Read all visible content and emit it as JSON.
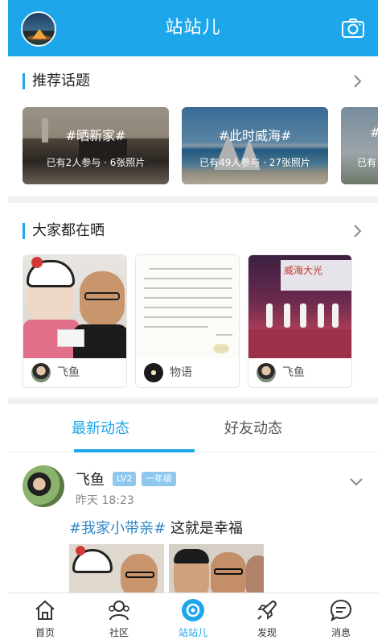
{
  "app": {
    "title": "站站儿"
  },
  "colors": {
    "accent": "#1ea6ea",
    "badge": "#8ec8ee",
    "tag": "#2f86c7"
  },
  "sections": {
    "recommended": {
      "title": "推荐话题",
      "topics": [
        {
          "tag": "#晒新家#",
          "meta": "已有2人参与 · 6张照片"
        },
        {
          "tag": "#此时威海#",
          "meta": "已有49人参与 · 27张照片"
        },
        {
          "tag": "#",
          "meta": "已有"
        }
      ]
    },
    "sharing": {
      "title": "大家都在晒",
      "cards": [
        {
          "user": "飞鱼"
        },
        {
          "user": "物语"
        },
        {
          "user": "飞鱼"
        }
      ],
      "stage_text": "威海大光"
    }
  },
  "tabs": {
    "latest": "最新动态",
    "friends": "好友动态"
  },
  "post": {
    "author": "飞鱼",
    "level": "LV2",
    "grade": "一年级",
    "time": "昨天 18:23",
    "hashtag": "#我家小带亲#",
    "content": " 这就是幸福"
  },
  "nav": [
    {
      "label": "首页",
      "icon": "home-icon"
    },
    {
      "label": "社区",
      "icon": "community-icon"
    },
    {
      "label": "站站儿",
      "icon": "camera-app-icon"
    },
    {
      "label": "发现",
      "icon": "rocket-icon"
    },
    {
      "label": "消息",
      "icon": "message-icon"
    }
  ]
}
